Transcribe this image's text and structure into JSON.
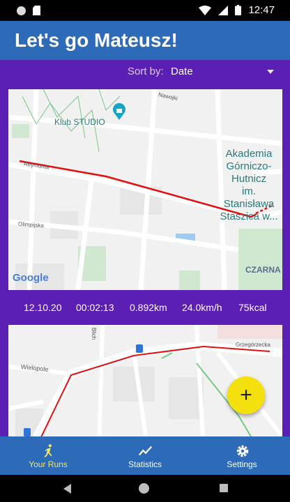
{
  "status_bar": {
    "time": "12:47"
  },
  "app_bar": {
    "title": "Let's go Mateusz!"
  },
  "sort": {
    "label": "Sort by:",
    "value": "Date"
  },
  "map1": {
    "place_klub": "Klub STUDIO",
    "academy_lines": [
      "Akademia",
      "Górniczo-Hutnicz",
      "im. Stanisława",
      "Staszica w..."
    ],
    "street_reymonta": "Reymonta",
    "street_nawojki": "Nawojki",
    "street_olimpijska": "Olimpijska",
    "district_czarna": "CZARNA",
    "google_logo": "Google"
  },
  "run1": {
    "date": "12.10.20",
    "duration": "00:02:13",
    "distance": "0.892km",
    "speed": "24.0km/h",
    "calories": "75kcal"
  },
  "map2": {
    "street_bilicha": "Blich",
    "street_grzegorzecka": "Grzegórzecka",
    "street_wielopole": "Wielopole"
  },
  "fab": {
    "label": "+"
  },
  "bottom_nav": {
    "items": [
      {
        "label": "Your Runs",
        "icon": "runner-icon",
        "active": true
      },
      {
        "label": "Statistics",
        "icon": "chart-line-icon",
        "active": false
      },
      {
        "label": "Settings",
        "icon": "gear-icon",
        "active": false
      }
    ]
  },
  "colors": {
    "primary": "#2d6ab8",
    "content_bg": "#5b1fb4",
    "accent": "#f3e00c",
    "route": "#e01010"
  }
}
